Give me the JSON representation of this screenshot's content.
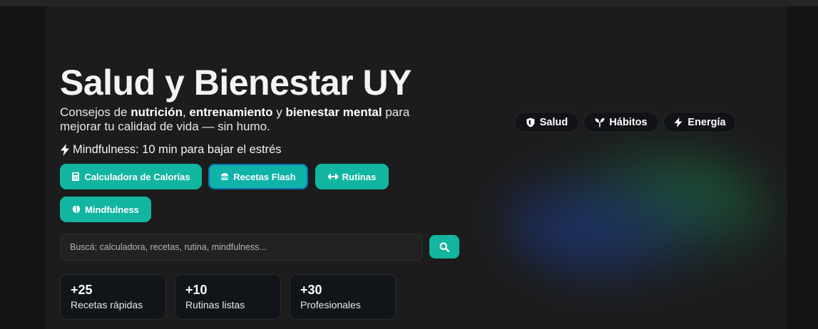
{
  "hero": {
    "title": "Salud y Bienestar UY",
    "subtitle": {
      "p1": "Consejos de ",
      "b1": "nutrición",
      "p2": ", ",
      "b2": "entrenamiento",
      "p3": " y ",
      "b3": "bienestar mental",
      "p4": " para mejorar tu calidad de vida — sin humo."
    },
    "tip": "Mindfulness: 10 min para bajar el estrés"
  },
  "buttons": [
    {
      "label": "Calculadora de Calorías",
      "icon": "calculator-icon"
    },
    {
      "label": "Recetas Flash",
      "icon": "burger-icon",
      "active": true
    },
    {
      "label": "Rutinas",
      "icon": "dumbbell-icon"
    },
    {
      "label": "Mindfulness",
      "icon": "brain-icon"
    }
  ],
  "search": {
    "placeholder": "Buscá: calculadora, recetas, rutina, mindfulness...",
    "button_icon": "search-icon"
  },
  "stats": [
    {
      "value": "+25",
      "label": "Recetas rápidas"
    },
    {
      "value": "+10",
      "label": "Rutinas listas"
    },
    {
      "value": "+30",
      "label": "Profesionales"
    }
  ],
  "pills": [
    {
      "label": "Salud",
      "icon": "shield-icon"
    },
    {
      "label": "Hábitos",
      "icon": "sprout-icon"
    },
    {
      "label": "Energía",
      "icon": "bolt-icon"
    }
  ],
  "colors": {
    "accent": "#12b5a0",
    "background": "#1c1c1c",
    "card": "#111418"
  }
}
